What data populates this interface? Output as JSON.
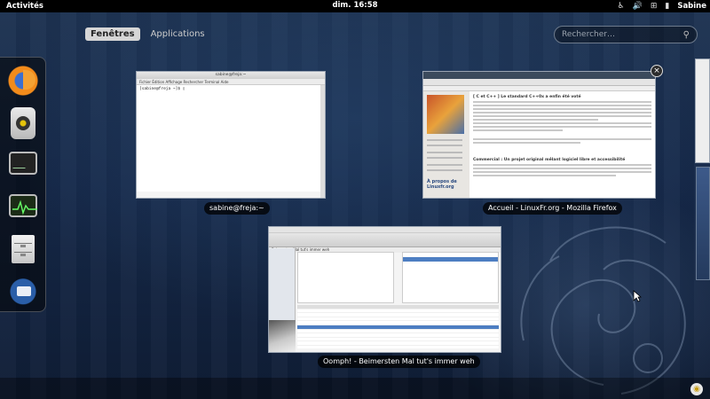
{
  "topbar": {
    "activities": "Activités",
    "clock": "dim. 16:58",
    "user": "Sabine",
    "icons": [
      "accessibility-icon",
      "volume-icon",
      "network-icon",
      "battery-icon"
    ]
  },
  "view_selector": {
    "windows": "Fenêtres",
    "applications": "Applications"
  },
  "search": {
    "placeholder": "Rechercher…"
  },
  "dash": {
    "items": [
      "firefox-icon",
      "rhythmbox-icon",
      "terminal-icon",
      "system-monitor-icon",
      "file-cabinet-icon",
      "thunderbird-icon"
    ]
  },
  "windows": {
    "terminal": {
      "caption": "sabine@freja:~",
      "title": "sabine@freja:~",
      "menu": "Fichier   Édition   Affichage   Rechercher   Terminal   Aide",
      "prompt": "[sabine@freja ~]$ ▯"
    },
    "firefox": {
      "caption": "Accueil - LinuxFr.org - Mozilla Firefox",
      "headline1": "[ C et C++ ] Le standard C++0x a enfin été voté",
      "headline2": "Commercial : Un projet original mêlant logiciel libre et accessibilité",
      "sidehead": "À propos de Linuxfr.org"
    },
    "banshee": {
      "caption": "Oomph! - Beimersten Mal tut's immer weh",
      "title": "Beimersten Mal tut's immer weh"
    }
  },
  "colors": {
    "topbar": "#000000",
    "active_tab": "#d6d6d6",
    "selection": "#4d7ec2"
  }
}
